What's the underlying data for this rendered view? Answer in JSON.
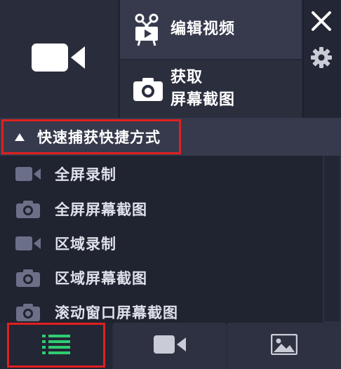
{
  "top": {
    "edit_video_label": "编辑视频",
    "screenshot_label_line1": "获取",
    "screenshot_label_line2": "屏幕截图"
  },
  "section": {
    "title": "快速捕获快捷方式",
    "expanded": true
  },
  "items": [
    {
      "icon": "video-camera-icon",
      "label": "全屏录制"
    },
    {
      "icon": "camera-icon",
      "label": "全屏屏幕截图"
    },
    {
      "icon": "video-camera-icon",
      "label": "区域录制"
    },
    {
      "icon": "camera-icon",
      "label": "区域屏幕截图"
    },
    {
      "icon": "camera-icon",
      "label": "滚动窗口屏幕截图"
    }
  ],
  "tabs": [
    {
      "name": "list",
      "icon": "list-icon",
      "active": true,
      "color": "#2ecc71"
    },
    {
      "name": "video",
      "icon": "video-camera-icon",
      "active": false
    },
    {
      "name": "image",
      "icon": "image-icon",
      "active": false
    }
  ],
  "colors": {
    "highlight": "#e02020",
    "accent_green": "#2ecc71"
  }
}
